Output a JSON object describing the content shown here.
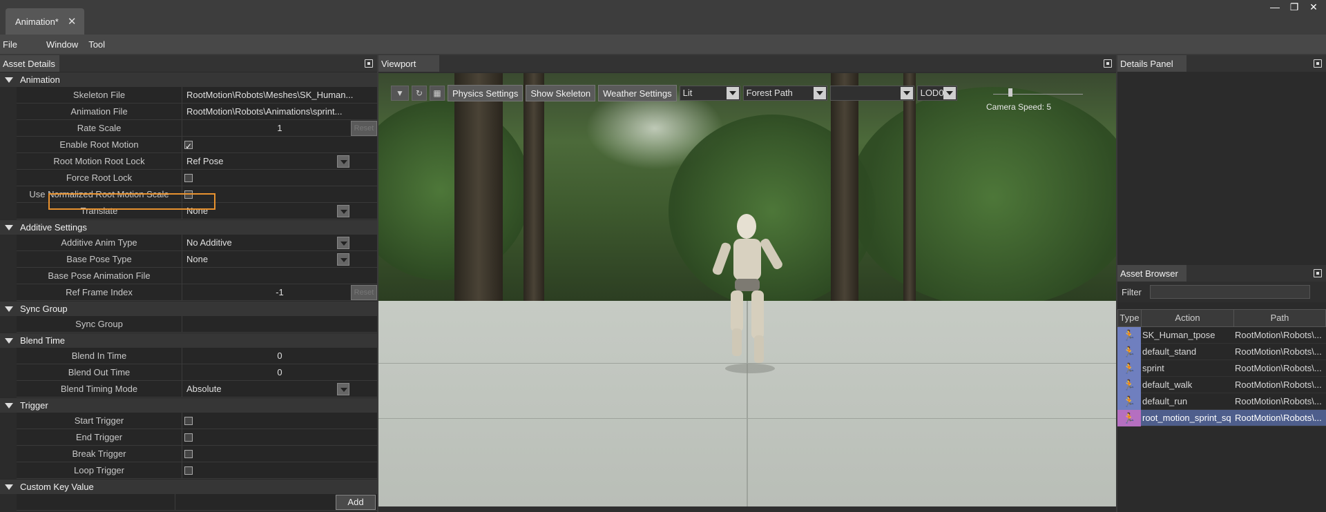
{
  "tab": {
    "title": "Animation*",
    "close": "✕"
  },
  "window": {
    "minimize": "—",
    "restore": "❐",
    "close": "✕"
  },
  "menu": {
    "file": "File",
    "window": "Window",
    "tool": "Tool"
  },
  "asset_details": {
    "title": "Asset Details",
    "sections": {
      "animation": {
        "title": "Animation",
        "skeleton_file_label": "Skeleton File",
        "skeleton_file_value": "RootMotion\\Robots\\Meshes\\SK_Human...",
        "animation_file_label": "Animation File",
        "animation_file_value": "RootMotion\\Robots\\Animations\\sprint...",
        "rate_scale_label": "Rate Scale",
        "rate_scale_value": "1",
        "reset_label": "Reset",
        "enable_root_motion_label": "Enable Root Motion",
        "root_motion_root_lock_label": "Root Motion Root Lock",
        "root_motion_root_lock_value": "Ref Pose",
        "force_root_lock_label": "Force Root Lock",
        "use_normalized_label": "Use Normalized Root Motion Scale",
        "translate_label": "Translate",
        "translate_value": "None"
      },
      "additive": {
        "title": "Additive Settings",
        "anim_type_label": "Additive Anim Type",
        "anim_type_value": "No Additive",
        "base_pose_type_label": "Base Pose Type",
        "base_pose_type_value": "None",
        "base_pose_file_label": "Base Pose Animation File",
        "ref_frame_label": "Ref Frame Index",
        "ref_frame_value": "-1",
        "reset_label": "Reset"
      },
      "sync": {
        "title": "Sync Group",
        "sync_group_label": "Sync Group"
      },
      "blend": {
        "title": "Blend Time",
        "in_label": "Blend In Time",
        "in_value": "0",
        "out_label": "Blend Out Time",
        "out_value": "0",
        "mode_label": "Blend Timing Mode",
        "mode_value": "Absolute"
      },
      "trigger": {
        "title": "Trigger",
        "start_label": "Start Trigger",
        "end_label": "End Trigger",
        "break_label": "Break Trigger",
        "loop_label": "Loop Trigger"
      },
      "custom": {
        "title": "Custom Key Value",
        "add_label": "Add"
      }
    }
  },
  "viewport": {
    "title": "Viewport",
    "physics_settings": "Physics Settings",
    "show_skeleton": "Show Skeleton",
    "weather_settings": "Weather Settings",
    "lighting_value": "Lit",
    "environment_value": "Forest Path",
    "empty_select_value": "",
    "lod_value": "LOD0",
    "camera_speed_label": "Camera Speed: 5"
  },
  "details_panel": {
    "title": "Details Panel"
  },
  "asset_browser": {
    "title": "Asset Browser",
    "filter_label": "Filter",
    "columns": {
      "type": "Type",
      "action": "Action",
      "path": "Path"
    },
    "rows": [
      {
        "name": "SK_Human_tpose",
        "path": "RootMotion\\Robots\\..."
      },
      {
        "name": "default_stand",
        "path": "RootMotion\\Robots\\..."
      },
      {
        "name": "sprint",
        "path": "RootMotion\\Robots\\..."
      },
      {
        "name": "default_walk",
        "path": "RootMotion\\Robots\\..."
      },
      {
        "name": "default_run",
        "path": "RootMotion\\Robots\\..."
      },
      {
        "name": "root_motion_sprint_sq",
        "path": "RootMotion\\Robots\\..."
      }
    ]
  }
}
